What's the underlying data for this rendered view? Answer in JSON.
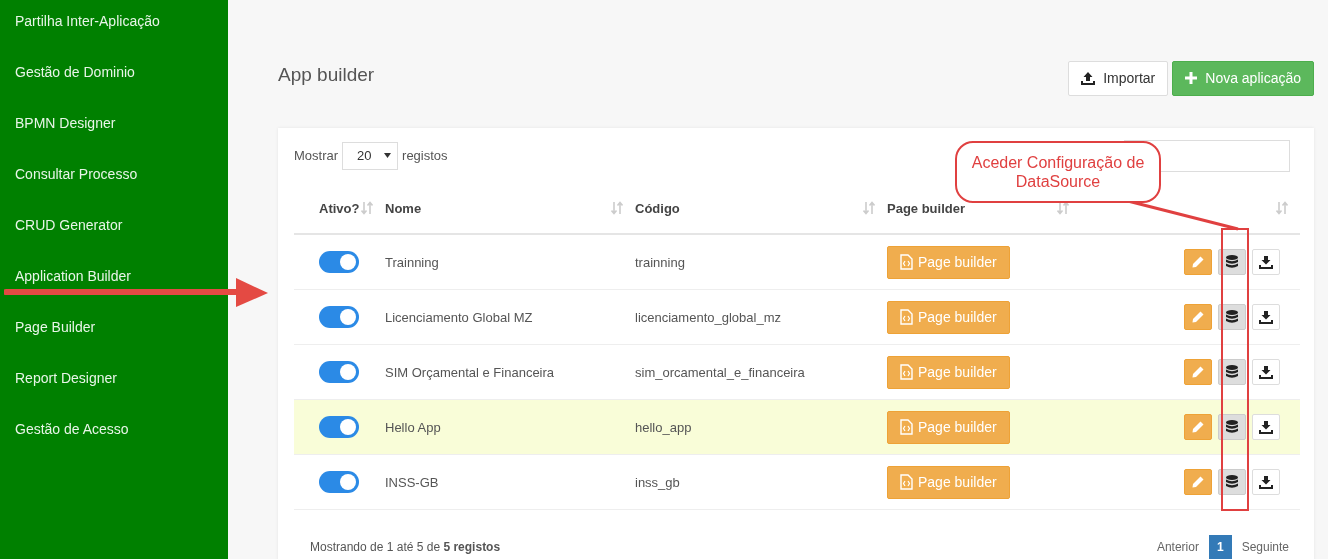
{
  "sidebar": {
    "items": [
      {
        "label": "Partilha Inter-Aplicação",
        "selected": false
      },
      {
        "label": "Gestão de Dominio",
        "selected": false
      },
      {
        "label": "BPMN Designer",
        "selected": false
      },
      {
        "label": "Consultar Processo",
        "selected": false
      },
      {
        "label": "CRUD Generator",
        "selected": false
      },
      {
        "label": "Application Builder",
        "selected": false
      },
      {
        "label": "Page Builder",
        "selected": false
      },
      {
        "label": "Report Designer",
        "selected": false
      },
      {
        "label": "Gestão de Acesso",
        "selected": false
      }
    ]
  },
  "page": {
    "title": "App builder",
    "buttons": [
      {
        "kind": "import",
        "label": "Importar"
      },
      {
        "kind": "new",
        "label": "Nova aplicação"
      }
    ]
  },
  "table": {
    "length_prefix": "Mostrar",
    "length_value": "20",
    "length_suffix": "registos",
    "columns": [
      {
        "label": "Ativo?",
        "sortable": true
      },
      {
        "label": "Nome",
        "sortable": true
      },
      {
        "label": "Código",
        "sortable": true
      },
      {
        "label": "Page builder",
        "sortable": true
      },
      {
        "sortable": true
      }
    ],
    "rows": [
      {
        "active": true,
        "highlighted": false,
        "name": "Trainning",
        "code": "trainning",
        "page_builder": "Page builder"
      },
      {
        "active": true,
        "highlighted": false,
        "name": "Licenciamento Global MZ",
        "code": "licenciamento_global_mz",
        "page_builder": "Page builder"
      },
      {
        "active": true,
        "highlighted": false,
        "name": "SIM Orçamental e Financeira",
        "code": "sim_orcamental_e_financeira",
        "page_builder": "Page builder"
      },
      {
        "active": true,
        "highlighted": true,
        "name": "Hello App",
        "code": "hello_app",
        "page_builder": "Page builder"
      },
      {
        "active": true,
        "highlighted": false,
        "name": "INSS-GB",
        "code": "inss_gb",
        "page_builder": "Page builder"
      }
    ],
    "info": "Mostrando de 1 até 5 de **5 registos**",
    "pagination": [
      {
        "label": "Anterior",
        "selected": false
      },
      {
        "label": "1",
        "selected": true
      },
      {
        "label": "Seguinte",
        "selected": false
      }
    ]
  },
  "annotation": {
    "callout": "Aceder Configuração de DataSource"
  }
}
